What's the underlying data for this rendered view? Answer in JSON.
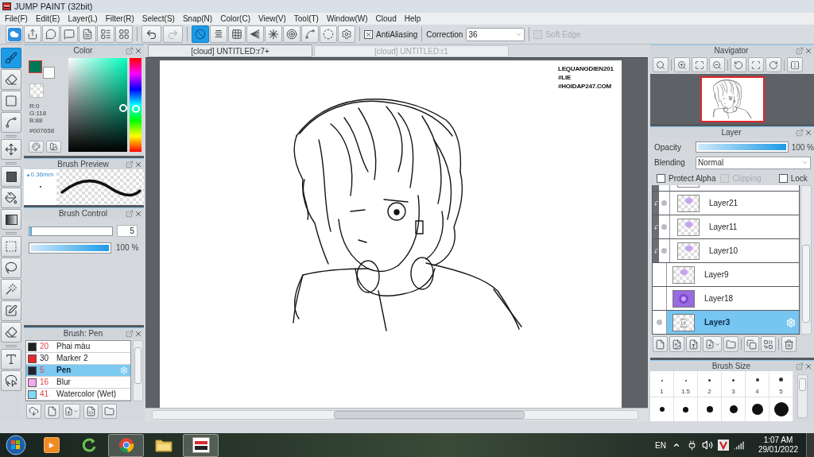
{
  "window": {
    "title": "JUMP PAINT (32bit)"
  },
  "menu": [
    "File(F)",
    "Edit(E)",
    "Layer(L)",
    "Filter(R)",
    "Select(S)",
    "Snap(N)",
    "Color(C)",
    "View(V)",
    "Tool(T)",
    "Window(W)",
    "Cloud",
    "Help"
  ],
  "toolbar": {
    "history": [
      {
        "disabled": false
      },
      {
        "disabled": true
      }
    ],
    "snap_modes": [
      {
        "selected": true
      },
      {
        "selected": false
      },
      {
        "selected": false
      },
      {
        "selected": false
      },
      {
        "selected": false
      },
      {
        "selected": false
      },
      {
        "selected": false
      },
      {
        "selected": false
      },
      {
        "selected": false
      }
    ],
    "antialiasing": {
      "label": "AntiAliasing",
      "checked": true
    },
    "correction": {
      "label": "Correction",
      "value": "36"
    },
    "soft_edge": {
      "label": "Soft Edge",
      "checked": false,
      "disabled": true
    }
  },
  "tool_groups": [
    [
      {
        "selected": true
      },
      {
        "selected": false
      },
      {
        "selected": false
      },
      {
        "selected": false
      }
    ],
    [
      {
        "selected": false
      }
    ],
    [
      {
        "selected": false
      },
      {
        "selected": false
      },
      {
        "selected": false
      }
    ],
    [
      {
        "selected": false
      },
      {
        "selected": false
      },
      {
        "selected": false
      },
      {
        "selected": false
      },
      {
        "selected": false
      }
    ],
    [
      {
        "selected": false
      },
      {
        "selected": false
      }
    ]
  ],
  "color_panel": {
    "title": "Color",
    "foreground": {
      "color": "#007658"
    },
    "background": {
      "color": "#ffffff"
    },
    "red": "R:0",
    "green": "G:118",
    "blue": "B:88",
    "hex": "#007658"
  },
  "brush_preview": {
    "title": "Brush Preview",
    "size": "0.36mm"
  },
  "brush_control": {
    "title": "Brush Control",
    "size": {
      "level": 0.03,
      "value": "5"
    },
    "opacity": {
      "level": 1,
      "value": "100 %"
    }
  },
  "brush_list": {
    "title": "Brush: Pen",
    "items": [
      {
        "color": "#222222",
        "count": "20",
        "accent": true,
        "name": "Phai màu",
        "selected": false
      },
      {
        "color": "#e8292b",
        "count": "30",
        "accent": false,
        "name": "Marker 2",
        "selected": false
      },
      {
        "color": "#1f2430",
        "count": "5",
        "accent": true,
        "name": "Pen",
        "selected": true
      },
      {
        "color": "#f5a8f0",
        "count": "16",
        "accent": true,
        "name": "Blur",
        "selected": false
      },
      {
        "color": "#7fd9f5",
        "count": "41",
        "accent": true,
        "name": "Watercolor (Wet)",
        "selected": false
      }
    ]
  },
  "canvas_tabs": [
    {
      "label": "[cloud] UNTITLED:r7+",
      "selected": true
    },
    {
      "label": "[cloud] UNTITLED:r1",
      "selected": false
    }
  ],
  "canvas": {
    "signature": [
      "LEQUANGDIEN201",
      "#LIE",
      "#HOIDAP247.COM"
    ]
  },
  "navigator": {
    "title": "Navigator"
  },
  "layer_panel": {
    "title": "Layer",
    "opacity": {
      "label": "Opacity",
      "level": 1,
      "value": "100 %"
    },
    "blending": {
      "label": "Blending",
      "value": "Normal"
    },
    "protect_alpha": {
      "label": "Protect Alpha",
      "checked": false
    },
    "clipping": {
      "label": "Clipping",
      "checked": false,
      "disabled": true
    },
    "lock": {
      "label": "Lock",
      "checked": false
    },
    "layers": [
      {
        "name": "Layer21",
        "visible": true,
        "clipped": true,
        "kind": "blob",
        "selected": false
      },
      {
        "name": "Layer11",
        "visible": true,
        "clipped": true,
        "kind": "blob",
        "selected": false
      },
      {
        "name": "Layer10",
        "visible": true,
        "clipped": true,
        "kind": "blob",
        "selected": false
      },
      {
        "name": "Layer9",
        "visible": false,
        "clipped": false,
        "kind": "blob",
        "selected": false
      },
      {
        "name": "Layer18",
        "visible": false,
        "clipped": false,
        "kind": "fill",
        "selected": false
      },
      {
        "name": "Layer3",
        "visible": true,
        "clipped": false,
        "kind": "lines",
        "selected": true
      }
    ]
  },
  "brush_size": {
    "title": "Brush Size",
    "labels": [
      "1",
      "1.5",
      "2",
      "3",
      "4",
      "5"
    ]
  },
  "taskbar": {
    "apps": [
      {
        "open": false
      },
      {
        "open": false
      },
      {
        "open": true
      },
      {
        "open": false
      },
      {
        "open": true
      }
    ],
    "language": "EN",
    "time": "1:07 AM",
    "date": "29/01/2022"
  }
}
